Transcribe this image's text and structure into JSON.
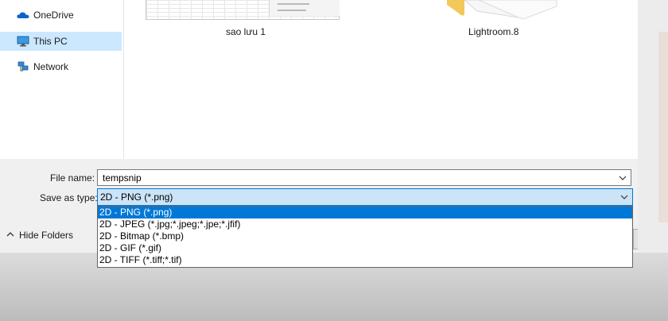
{
  "nav": {
    "items": [
      {
        "label": "OneDrive",
        "icon": "onedrive-cloud-icon",
        "selected": false
      },
      {
        "label": "This PC",
        "icon": "this-pc-monitor-icon",
        "selected": true
      },
      {
        "label": "Network",
        "icon": "network-icon",
        "selected": false
      }
    ]
  },
  "files": [
    {
      "name": "sao lưu 1",
      "icon": "spreadsheet-thumbnail"
    },
    {
      "name": "Lightroom.8",
      "icon": "folder-icon"
    }
  ],
  "footer": {
    "file_name_label": "File name:",
    "file_name_value": "tempsnip",
    "save_type_label": "Save as type:",
    "save_type_value": "2D - PNG (*.png)",
    "hide_folders_label": "Hide Folders"
  },
  "dropdown": {
    "options": [
      {
        "label": "2D - PNG (*.png)",
        "selected": true
      },
      {
        "label": "2D - JPEG (*.jpg;*.jpeg;*.jpe;*.jfif)",
        "selected": false
      },
      {
        "label": "2D - Bitmap (*.bmp)",
        "selected": false
      },
      {
        "label": "2D - GIF (*.gif)",
        "selected": false
      },
      {
        "label": "2D - TIFF (*.tiff;*.tif)",
        "selected": false
      }
    ]
  },
  "colors": {
    "accent": "#0078d7",
    "selection_light": "#cce8ff",
    "folder": "#f6d27a"
  }
}
